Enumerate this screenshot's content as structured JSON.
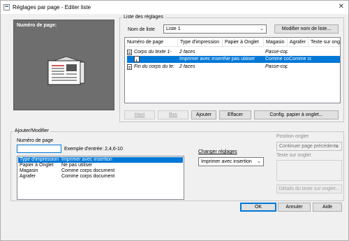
{
  "window": {
    "title": "Réglages par page - Editer liste",
    "close_glyph": "✕"
  },
  "preview": {
    "label": "Numéro de page:"
  },
  "list_group": {
    "title": "Liste des réglages",
    "list_name_label": "Nom de liste",
    "list_name_value": "Liste 1",
    "rename_button": "Modifier nom de liste...",
    "columns": [
      "Numéro de page",
      "Type d'impression",
      "Papier à Onglet",
      "Magasin",
      "Agrafer",
      "Texte sur ongl"
    ],
    "rows": [
      {
        "page": "Corps du texte 1-",
        "type": "2 faces",
        "onglet": "",
        "magasin": "Passe-cop",
        "agrafer": "",
        "texte": "",
        "italic": true,
        "selected": false,
        "indent": false
      },
      {
        "page": "",
        "type": "Imprimer avec insertion",
        "onglet": "Ne pas utiliser",
        "magasin": "Comme corps",
        "agrafer": "Comme cc",
        "texte": "",
        "italic": false,
        "selected": true,
        "indent": true
      },
      {
        "page": "Fin du corps du te:",
        "type": "2 faces",
        "onglet": "",
        "magasin": "Passe-cop",
        "agrafer": "",
        "texte": "",
        "italic": true,
        "selected": false,
        "indent": false
      }
    ],
    "buttons": {
      "up": "Haut",
      "down": "Bas",
      "add": "Ajouter",
      "delete": "Effacer",
      "tab_config": "Config. papier à onglet..."
    }
  },
  "add_modify": {
    "title": "Ajouter/Modifier",
    "page_number_label": "Numéro de page",
    "page_number_value": "",
    "example": "Exemple d'entrée: 2,4,6-10",
    "settings": [
      {
        "key": "Type d'impression",
        "value": "Imprimer avec insertion",
        "selected": true
      },
      {
        "key": "Papier à Onglet",
        "value": "Ne pas utiliser",
        "selected": false
      },
      {
        "key": "Magasin",
        "value": "Comme corps document",
        "selected": false
      },
      {
        "key": "Agrafer",
        "value": "Comme corps document",
        "selected": false
      }
    ],
    "change_label": "Changer réglages",
    "change_value": "Imprimer avec insertion",
    "tab_position_label": "Position onglet",
    "tab_position_value": "Continuer page précédente",
    "tab_text_label": "Texte sur onglet",
    "tab_text_details_button": "Détails du texte sur onglet..."
  },
  "footer": {
    "ok": "OK",
    "cancel": "Annuler",
    "help": "Aide"
  }
}
